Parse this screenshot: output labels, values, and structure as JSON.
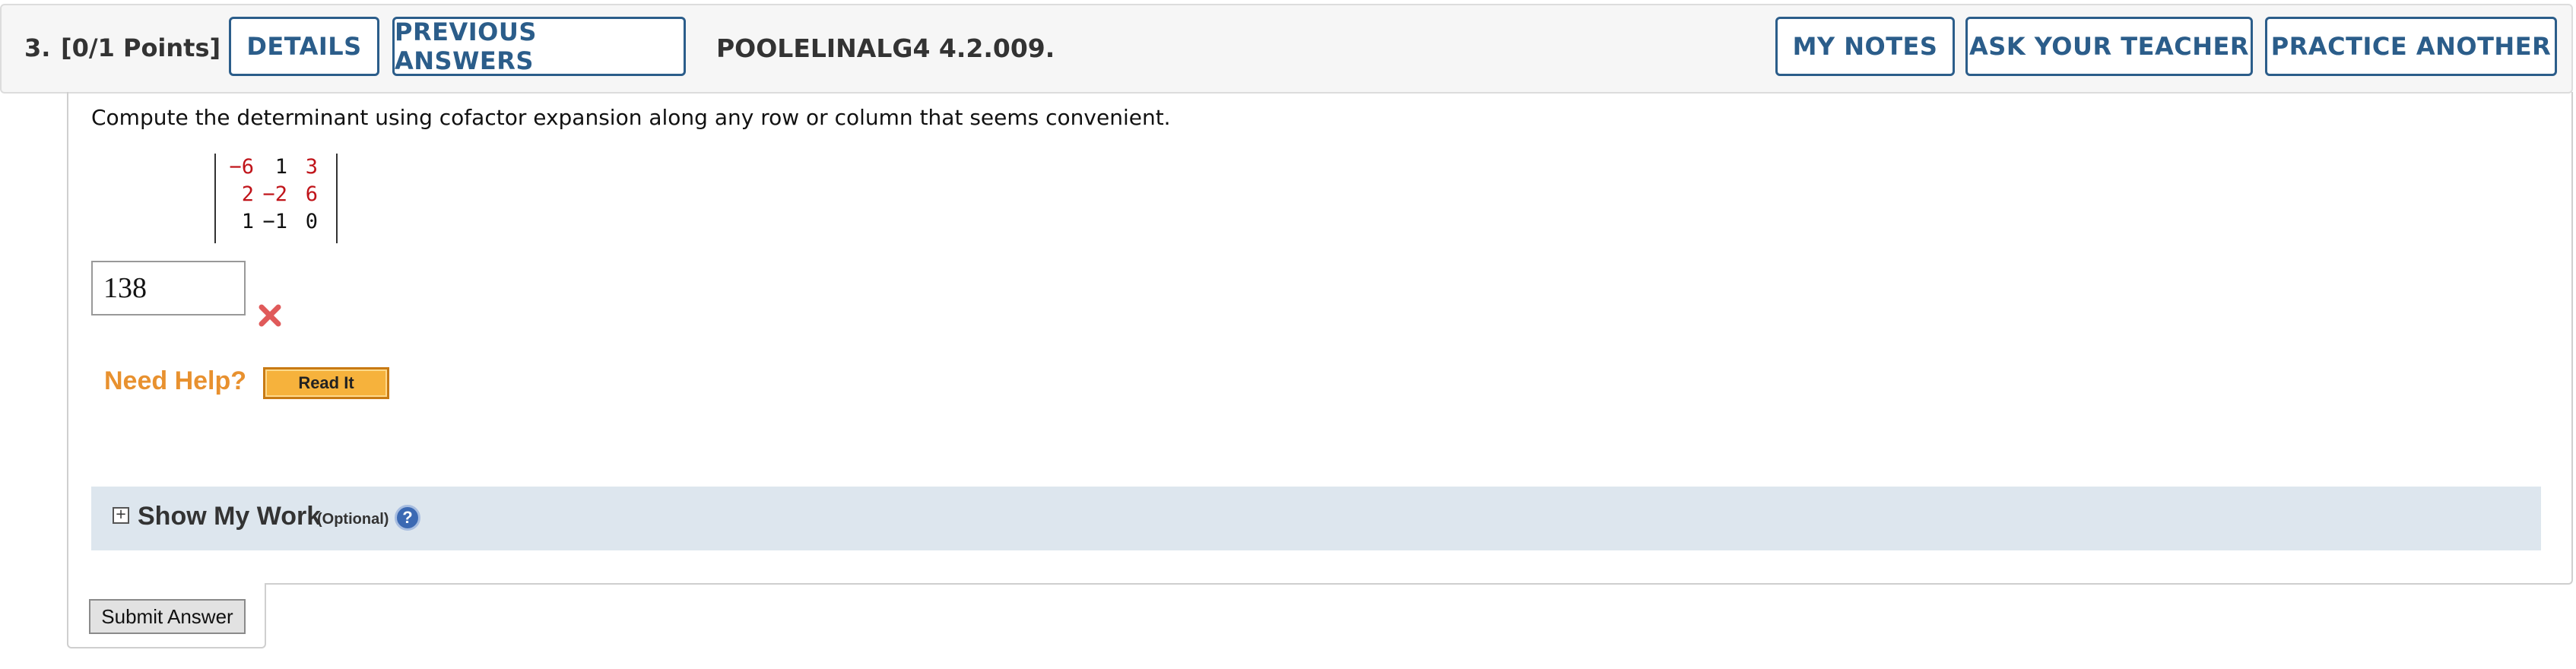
{
  "header": {
    "question_number": "3.",
    "points": "[0/1 Points]",
    "details_label": "DETAILS",
    "previous_answers_label": "PREVIOUS ANSWERS",
    "question_ref": "POOLELINALG4 4.2.009.",
    "my_notes_label": "MY NOTES",
    "ask_teacher_label": "ASK YOUR TEACHER",
    "practice_another_label": "PRACTICE ANOTHER"
  },
  "question": {
    "prompt": "Compute the determinant using cofactor expansion along any row or column that seems convenient.",
    "matrix": [
      [
        "−6",
        "1",
        "3"
      ],
      [
        "2",
        "−2",
        "6"
      ],
      [
        "1",
        "−1",
        "0"
      ]
    ],
    "matrix_colors": [
      [
        "#c0141a",
        "#111111",
        "#c0141a"
      ],
      [
        "#c0141a",
        "#c0141a",
        "#c0141a"
      ],
      [
        "#111111",
        "#111111",
        "#111111"
      ]
    ],
    "answer_value": "138",
    "answer_status_icon": "incorrect-x-icon"
  },
  "help": {
    "need_help_label": "Need Help?",
    "read_it_label": "Read It"
  },
  "show_my_work": {
    "label": "Show My Work",
    "optional_label": "(Optional)",
    "help_icon_label": "?"
  },
  "submit": {
    "label": "Submit Answer"
  },
  "colors": {
    "accent_blue": "#2b5d8a",
    "need_help_orange": "#e8912f",
    "incorrect_red": "#e05a5a"
  }
}
